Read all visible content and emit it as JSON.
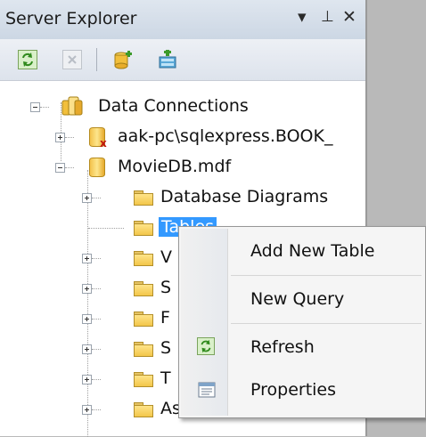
{
  "panel": {
    "title": "Server Explorer",
    "ctrl_dropdown": "▾",
    "ctrl_pin": "ᵾ",
    "ctrl_close": "✕"
  },
  "toolbar": {
    "buttons": [
      "refresh-icon",
      "stop-icon",
      "connect-to-database-icon",
      "connect-to-server-icon"
    ]
  },
  "tree": {
    "root_label": "Data Connections",
    "connections": [
      {
        "label": "aak-pc\\sqlexpress.BOOK_"
      },
      {
        "label": "MovieDB.mdf"
      }
    ],
    "nodes": [
      {
        "label": "Database Diagrams"
      },
      {
        "label": "Tables"
      },
      {
        "label": "V"
      },
      {
        "label": "S"
      },
      {
        "label": "F"
      },
      {
        "label": "S"
      },
      {
        "label": "T"
      },
      {
        "label": "Assemblies"
      }
    ]
  },
  "context_menu": {
    "items": [
      {
        "label": "Add New Table",
        "icon": ""
      },
      {
        "label": "New Query",
        "icon": ""
      },
      {
        "label": "Refresh",
        "icon": "refresh-icon"
      },
      {
        "label": "Properties",
        "icon": "properties-icon"
      }
    ]
  },
  "colors": {
    "selection": "#3399ff",
    "title_bar": "#ccd7e4",
    "menu_bg": "#f5f5f5",
    "folder": "#f3c64a"
  }
}
